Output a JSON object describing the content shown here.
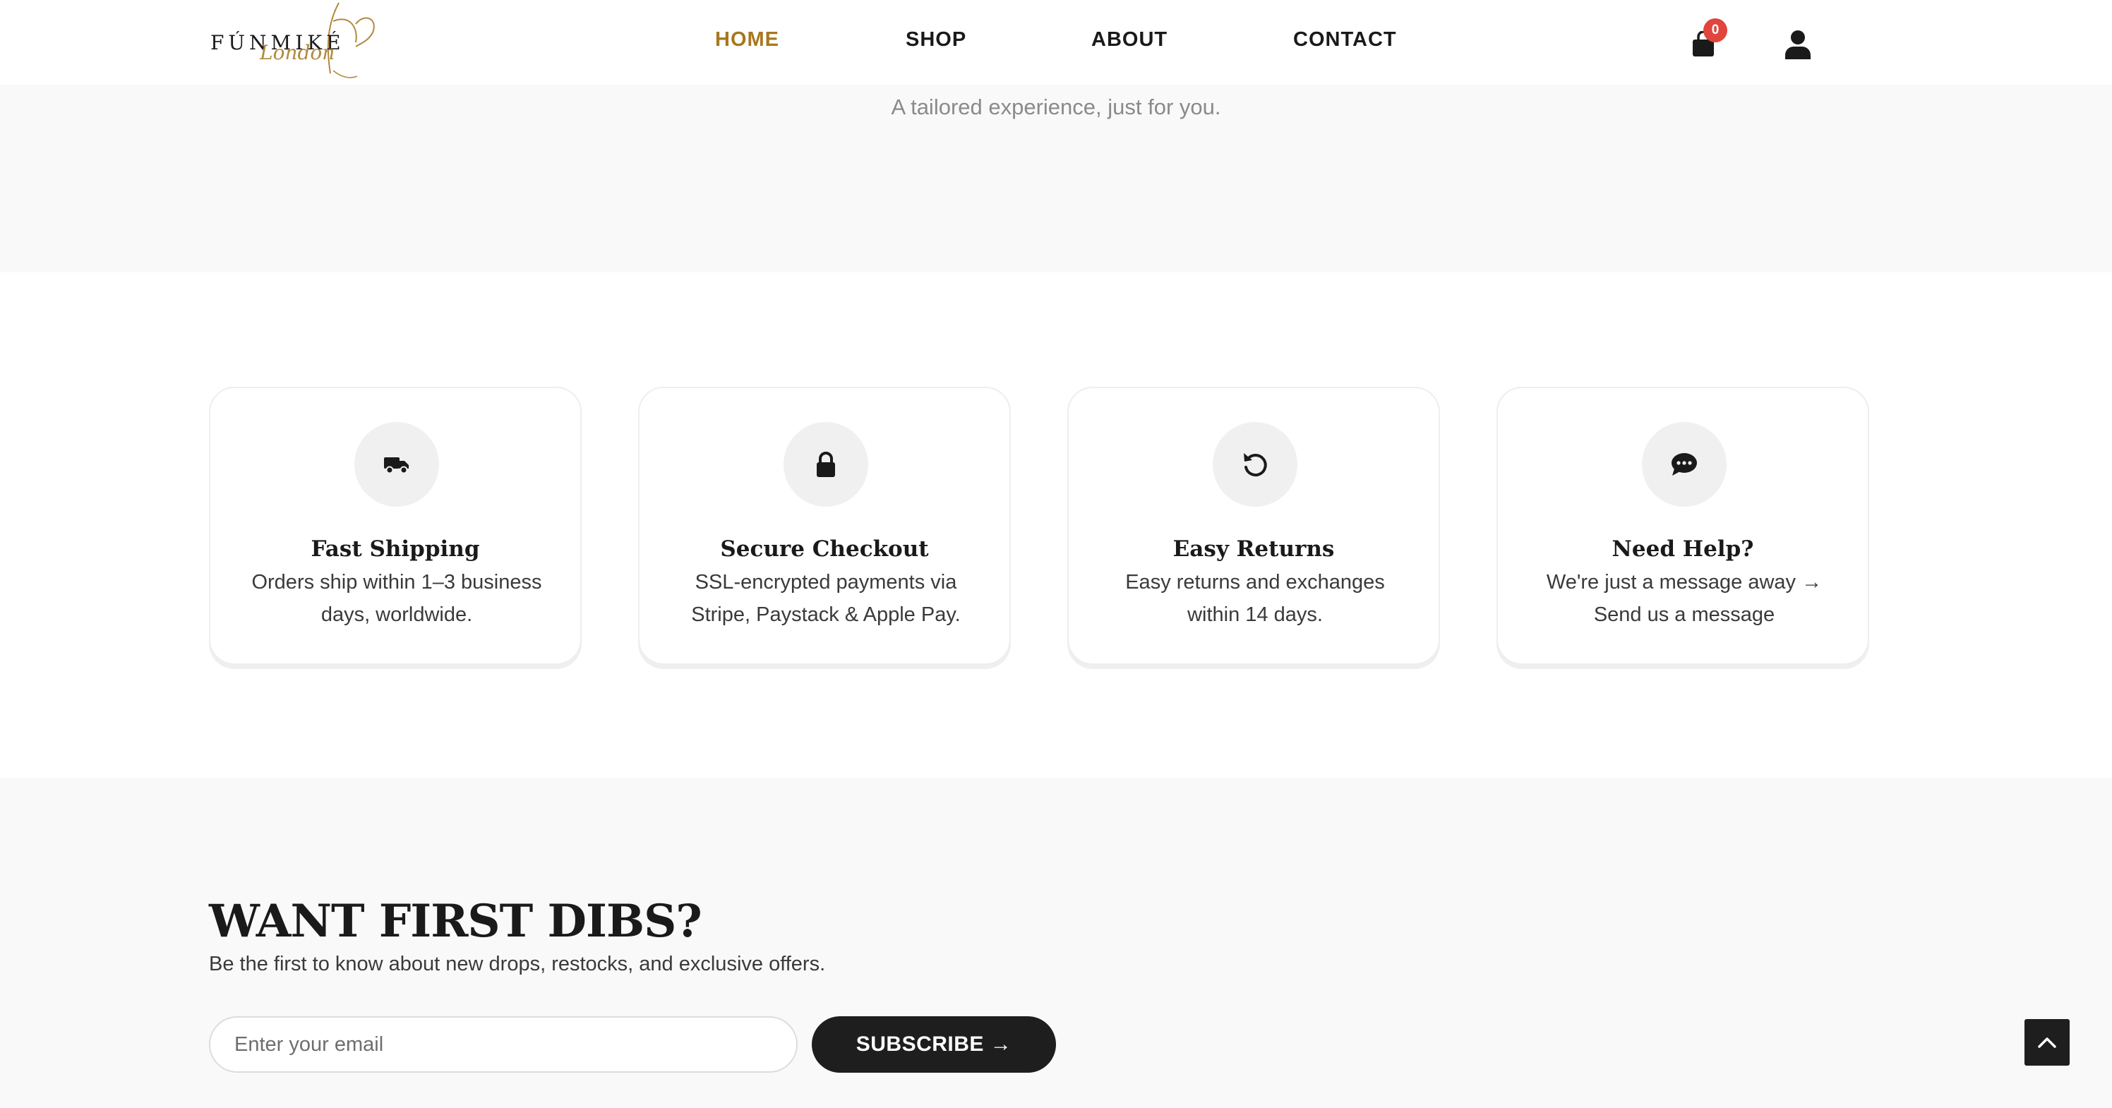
{
  "header": {
    "logo_text": "FÚNMIKÉ",
    "logo_script": "London",
    "nav": [
      {
        "label": "HOME",
        "active": true
      },
      {
        "label": "SHOP",
        "active": false
      },
      {
        "label": "ABOUT",
        "active": false
      },
      {
        "label": "CONTACT",
        "active": false
      }
    ],
    "cart_count": "0",
    "cart_icon": "shopping-bag-icon",
    "user_icon": "user-icon"
  },
  "hero": {
    "subtitle": "A tailored experience, just for you."
  },
  "features": [
    {
      "icon": "truck-icon",
      "title": "Fast Shipping",
      "description": "Orders ship within 1–3 business days, worldwide."
    },
    {
      "icon": "lock-icon",
      "title": "Secure Checkout",
      "description": "SSL-encrypted payments via Stripe, Paystack & Apple Pay."
    },
    {
      "icon": "rotate-left-icon",
      "title": "Easy Returns",
      "description": "Easy returns and exchanges within 14 days."
    },
    {
      "icon": "chat-icon",
      "title": "Need Help?",
      "description": "We're just a message away → Send us a message"
    }
  ],
  "newsletter": {
    "title": "WANT FIRST DIBS?",
    "subtitle": "Be the first to know about new drops, restocks, and exclusive offers.",
    "email_placeholder": "Enter your email",
    "button_label": "SUBSCRIBE →"
  },
  "back_to_top_icon": "chevron-up-icon",
  "colors": {
    "accent": "#a7771f",
    "dark": "#1e1e1e",
    "badge": "#e0463d",
    "section_bg": "#f9f9f9"
  }
}
